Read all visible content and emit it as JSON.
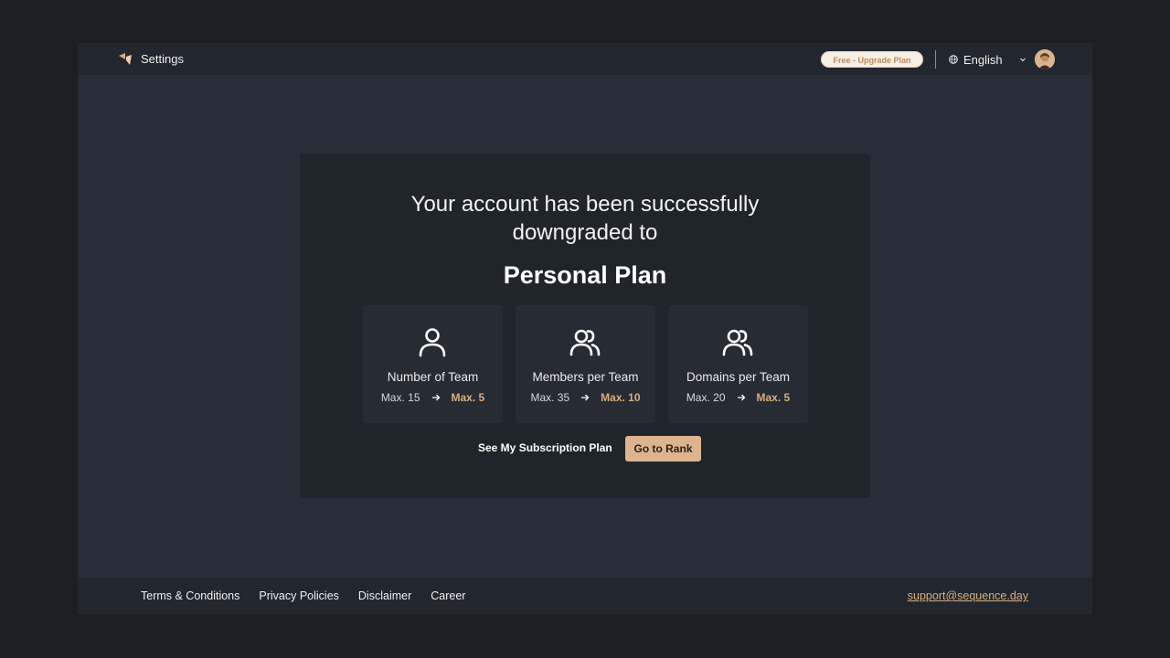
{
  "header": {
    "title": "Settings",
    "upgrade_label": "Free - Upgrade Plan",
    "language": "English"
  },
  "main": {
    "headline_line1": "Your account has been successfully",
    "headline_line2": "downgraded to",
    "plan_name": "Personal Plan",
    "limits": [
      {
        "icon": "user-icon",
        "label": "Number of Team",
        "old": "Max. 15",
        "new": "Max. 5"
      },
      {
        "icon": "users-icon",
        "label": "Members per Team",
        "old": "Max. 35",
        "new": "Max. 10"
      },
      {
        "icon": "users-icon",
        "label": "Domains per Team",
        "old": "Max. 20",
        "new": "Max. 5"
      }
    ],
    "see_plan_label": "See My Subscription Plan",
    "go_rank_label": "Go to Rank"
  },
  "footer": {
    "links": [
      "Terms & Conditions",
      "Privacy Policies",
      "Disclaimer",
      "Career"
    ],
    "support_email": "support@sequence.day"
  },
  "colors": {
    "accent": "#ddb48d",
    "background": "#282d37",
    "card": "#20242b"
  }
}
